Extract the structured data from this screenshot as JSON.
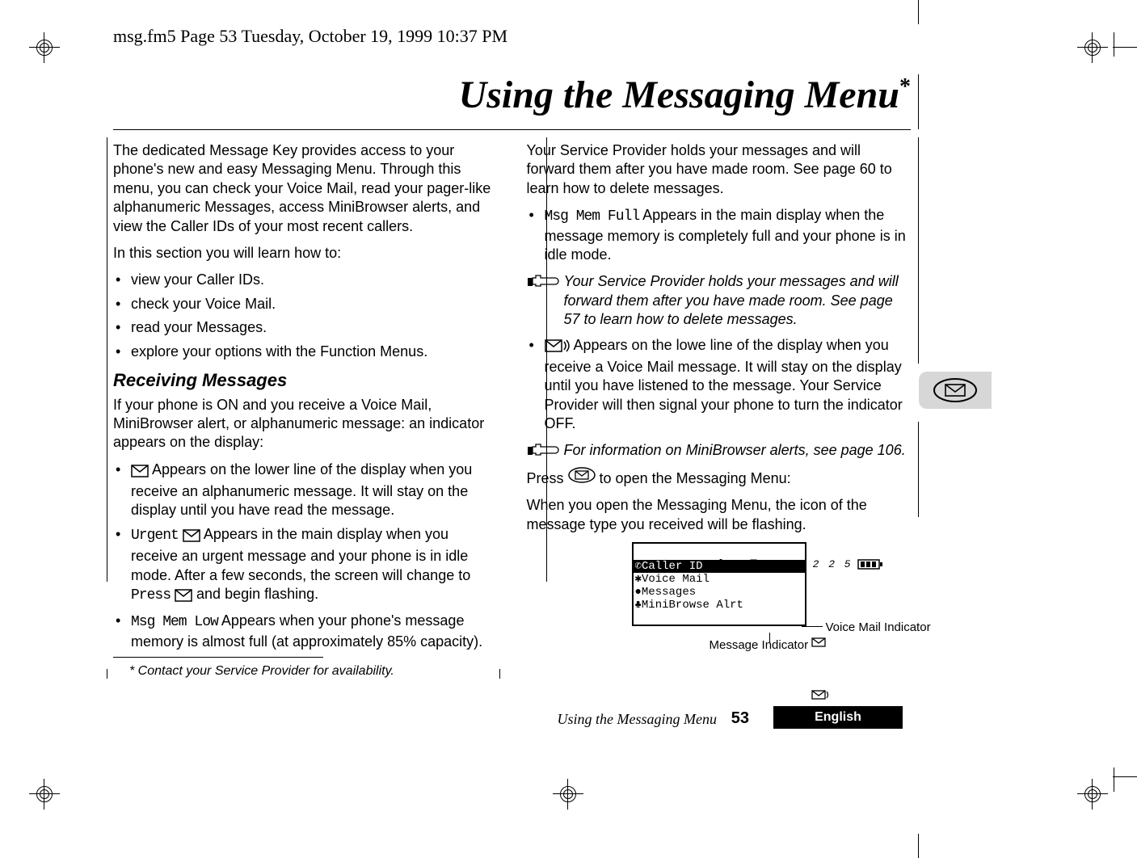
{
  "running_header": "msg.fm5  Page 53  Tuesday, October 19, 1999  10:37 PM",
  "title": "Using the Messaging Menu",
  "title_marker": "*",
  "intro1": "The dedicated Message Key provides access to your phone's new and easy Messaging Menu. Through this menu, you can check your Voice Mail, read your pager-like alphanumeric Messages, access MiniBrowser alerts, and view the Caller IDs of your most recent callers.",
  "intro2": "In this section you will learn how to:",
  "learn_bullets": [
    "view your Caller IDs.",
    "check your Voice Mail.",
    "read your Messages.",
    "explore your options with the Function Menus."
  ],
  "h_receiving": "Receiving Messages",
  "recv_intro": "If your phone is ON and you receive a Voice Mail, MiniBrowser alert, or alphanumeric message: an indicator appears on the display:",
  "recv_b1_a": " Appears on the lower line of the display when you receive an alphanumeric message. It will stay on the display until you have read the message.",
  "recv_b2_pre": "Urgent",
  "recv_b2_a": " Appears in the main display when you receive an urgent message and your phone is in idle mode. After a few seconds, the screen will change to ",
  "recv_b2_mid": "Press",
  "recv_b2_b": " and begin flashing.",
  "recv_b3_pre": "Msg Mem Low",
  "recv_b3_a": " Appears when your phone's message memory is almost full (at approximately 85% capacity).",
  "col2_p1": "Your Service Provider holds your messages and will forward them after you have made room. See page 60 to learn how to delete messages.",
  "col2_b1_pre": "Msg Mem Full",
  "col2_b1_a": " Appears in the main display when the message memory is completely full and your phone is in idle mode.",
  "col2_note1": "Your Service Provider holds your messages and will forward them after you have made room. See page 57 to learn how to delete messages.",
  "col2_b2_a": " Appears on the lowe line of the display when you receive a Voice Mail message. It will stay on the display until you have listened to the message. Your Service Provider will then signal your phone to turn the indicator OFF.",
  "col2_note2": "For information on MiniBrowser alerts, see page 106.",
  "col2_press_a": "Press ",
  "col2_press_b": " to open the Messaging Menu:",
  "col2_p2": "When you open the Messaging Menu, the icon of the message type you received will be flashing.",
  "screen": {
    "time": "1 2 2 5",
    "menu": [
      "Caller ID",
      "Voice Mail",
      "Messages",
      "MiniBrowse Alrt"
    ]
  },
  "callout_vm": "Voice Mail Indicator",
  "callout_msg": "Message Indicator",
  "footnote": "*  Contact your Service Provider for availability.",
  "footer_title": "Using the Messaging Menu",
  "page_number": "53",
  "language": "English"
}
